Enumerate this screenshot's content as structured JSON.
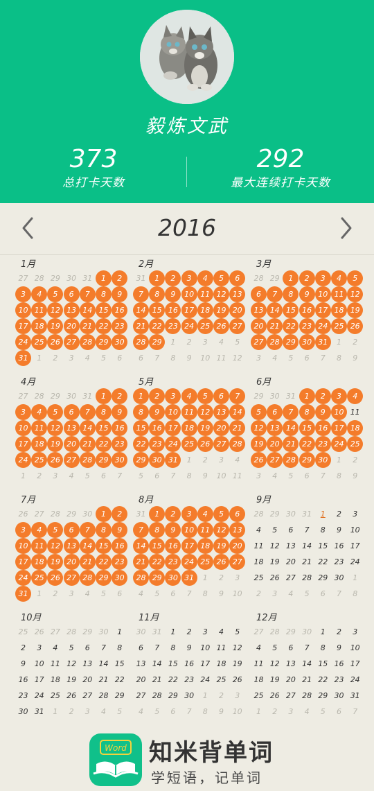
{
  "profile": {
    "name": "毅炼文武"
  },
  "stats": [
    {
      "value": "373",
      "label": "总打卡天数"
    },
    {
      "value": "292",
      "label": "最大连续打卡天数"
    }
  ],
  "calendar": {
    "year": "2016",
    "colors": {
      "checked": "#f47c2b",
      "header": "#0abf87",
      "background": "#eeece3"
    },
    "months": [
      {
        "label": "1月",
        "lead": [
          27,
          28,
          29,
          30,
          31
        ],
        "count": 31,
        "checked": "all",
        "trail": [
          1,
          2,
          3,
          4,
          5,
          6
        ]
      },
      {
        "label": "2月",
        "lead": [
          31
        ],
        "count": 29,
        "checked": "all",
        "trail": [
          1,
          2,
          3,
          4,
          5,
          6,
          7,
          8,
          9,
          10,
          11,
          12
        ]
      },
      {
        "label": "3月",
        "lead": [
          28,
          29
        ],
        "count": 31,
        "checked": "all",
        "trail": [
          1,
          2,
          3,
          4,
          5,
          6,
          7,
          8,
          9
        ]
      },
      {
        "label": "4月",
        "lead": [
          27,
          28,
          29,
          30,
          31
        ],
        "count": 30,
        "checked": "all",
        "trail": [
          1,
          2,
          3,
          4,
          5,
          6,
          7
        ]
      },
      {
        "label": "5月",
        "lead": [],
        "count": 31,
        "checked": "all",
        "trail": [
          1,
          2,
          3,
          4,
          5,
          6,
          7,
          8,
          9,
          10,
          11
        ]
      },
      {
        "label": "6月",
        "lead": [
          29,
          30,
          31
        ],
        "count": 30,
        "checked": "all",
        "checked_except": [
          11
        ],
        "trail": [
          1,
          2,
          3,
          4,
          5,
          6,
          7,
          8,
          9
        ]
      },
      {
        "label": "7月",
        "lead": [
          26,
          27,
          28,
          29,
          30
        ],
        "count": 31,
        "checked": "all",
        "trail": [
          1,
          2,
          3,
          4,
          5,
          6
        ]
      },
      {
        "label": "8月",
        "lead": [
          31
        ],
        "count": 31,
        "checked": "all",
        "trail": [
          1,
          2,
          3,
          4,
          5,
          6,
          7,
          8,
          9,
          10
        ]
      },
      {
        "label": "9月",
        "lead": [
          28,
          29,
          30,
          31
        ],
        "count": 30,
        "checked": "none",
        "today": 1,
        "trail": [
          1,
          2,
          3,
          4,
          5,
          6,
          7,
          8
        ]
      },
      {
        "label": "10月",
        "lead": [
          25,
          26,
          27,
          28,
          29,
          30
        ],
        "count": 31,
        "checked": "none",
        "trail": [
          1,
          2,
          3,
          4,
          5
        ]
      },
      {
        "label": "11月",
        "lead": [
          30,
          31
        ],
        "count": 30,
        "checked": "none",
        "trail": [
          1,
          2,
          3,
          4,
          5,
          6,
          7,
          8,
          9,
          10
        ]
      },
      {
        "label": "12月",
        "lead": [
          27,
          28,
          29,
          30
        ],
        "count": 31,
        "checked": "none",
        "trail": [
          1,
          2,
          3,
          4,
          5,
          6,
          7
        ]
      }
    ]
  },
  "footer": {
    "brand": "知米背单词",
    "slogan": "学短语，记单词",
    "logo_text": "Word"
  }
}
